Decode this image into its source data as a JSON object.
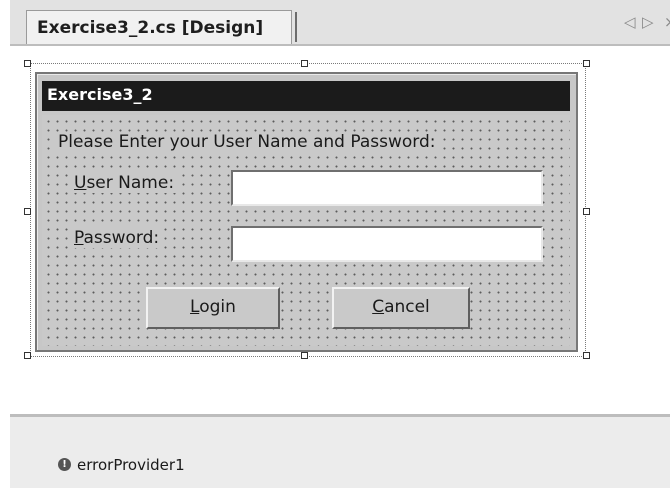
{
  "tab": {
    "label": "Exercise3_2.cs [Design]",
    "nav_prev_icon": "◁",
    "nav_next_icon": "▷",
    "close_icon": "×"
  },
  "form": {
    "title": "Exercise3_2",
    "prompt": "Please Enter your User Name and Password:",
    "username_label_prefix": "",
    "username_label_mnemonic": "U",
    "username_label_rest": "ser Name:",
    "password_label_mnemonic": "P",
    "password_label_rest": "assword:",
    "username_value": "",
    "password_value": "",
    "login_mnemonic": "L",
    "login_rest": "ogin",
    "cancel_mnemonic": "C",
    "cancel_rest": "ancel"
  },
  "tray": {
    "component_label": "errorProvider1",
    "component_icon": "!"
  },
  "colors": {
    "titlebar": "#1b1b1b",
    "form_background": "#c9c9c9",
    "tray_background": "#ececec"
  }
}
